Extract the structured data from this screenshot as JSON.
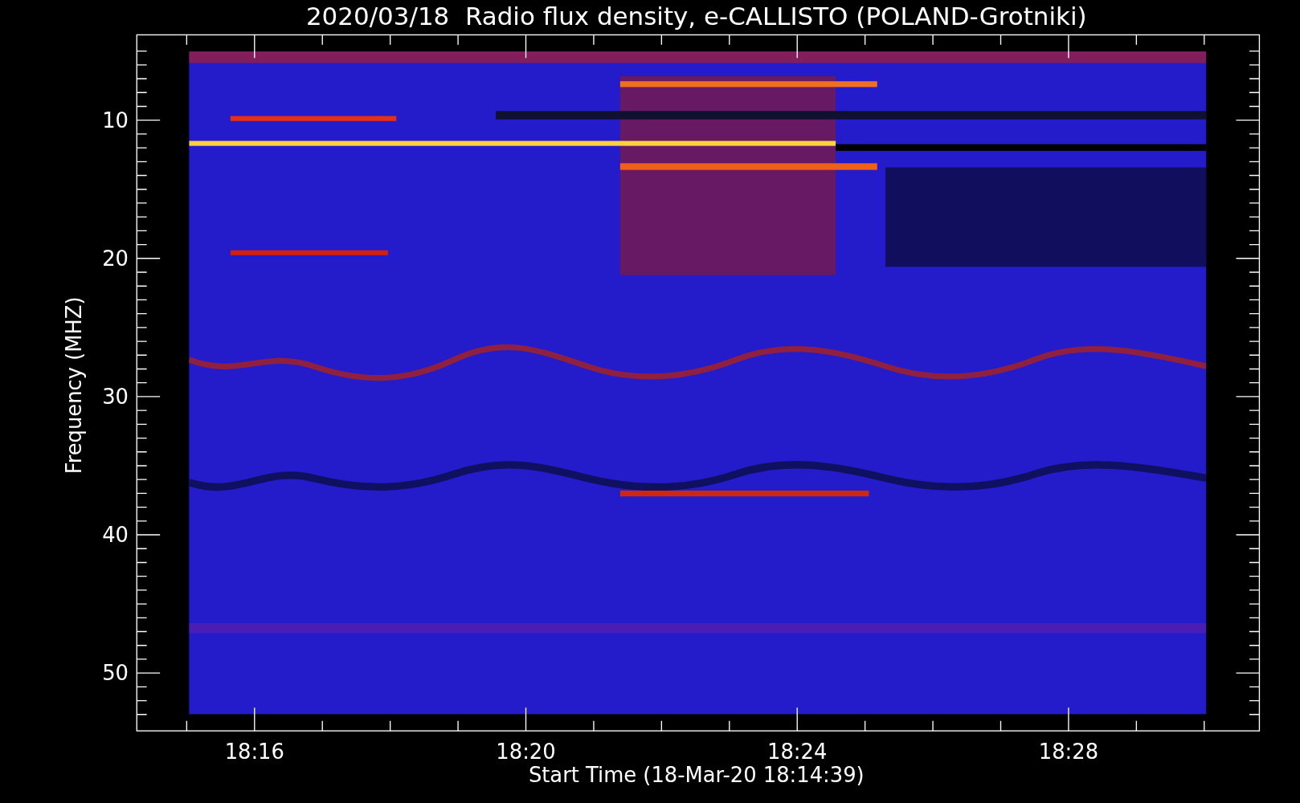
{
  "title": "2020/03/18  Radio flux density, e-CALLISTO (POLAND-Grotniki)",
  "y_axis": {
    "label": "Frequency (MHZ)",
    "ticks": [
      "10",
      "20",
      "30",
      "40",
      "50"
    ]
  },
  "x_axis": {
    "label": "Start Time (18-Mar-20 18:14:39)",
    "ticks": [
      "18:16",
      "18:20",
      "18:24",
      "18:28"
    ]
  }
}
